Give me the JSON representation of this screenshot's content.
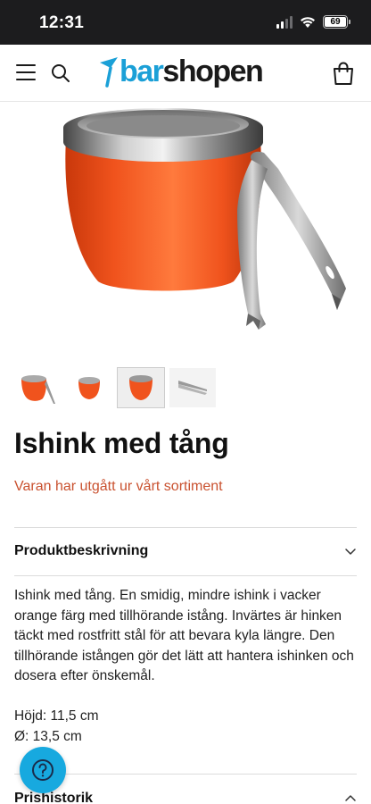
{
  "status_bar": {
    "time": "12:31",
    "battery": "69",
    "icons": [
      "signal-icon",
      "wifi-icon",
      "battery-icon"
    ]
  },
  "header": {
    "logo_part1": "bar",
    "logo_part2": "shopen",
    "icons": [
      "hamburger-menu-icon",
      "search-icon",
      "shopping-bag-icon"
    ],
    "brand_color": "#1ba0d7"
  },
  "product": {
    "title": "Ishink med tång",
    "availability": "Varan har utgått ur vårt sortiment",
    "thumbnails": [
      "ice-bucket-with-tongs",
      "ice-bucket-side",
      "ice-bucket-front",
      "tongs"
    ],
    "selected_thumbnail": 2
  },
  "sections": {
    "description": {
      "title": "Produktbeskrivning",
      "text": "Ishink med tång. En smidig, mindre ishink i vacker orange färg med tillhörande istång. Invärtes är hinken täckt med rostfritt stål för att bevara kyla längre. Den tillhörande istången gör det lätt att hantera ishinken och dosera efter önskemål.",
      "height": "Höjd: 11,5 cm",
      "diameter": "Ø: 13,5 cm"
    },
    "price_history": {
      "title": "Prishistorik"
    }
  },
  "help_button": {
    "icon": "question-mark-icon",
    "color": "#17a9df"
  },
  "colors": {
    "accent": "#1ba0d7",
    "availability": "#c9512f",
    "bucket_orange": "#f0531d"
  }
}
